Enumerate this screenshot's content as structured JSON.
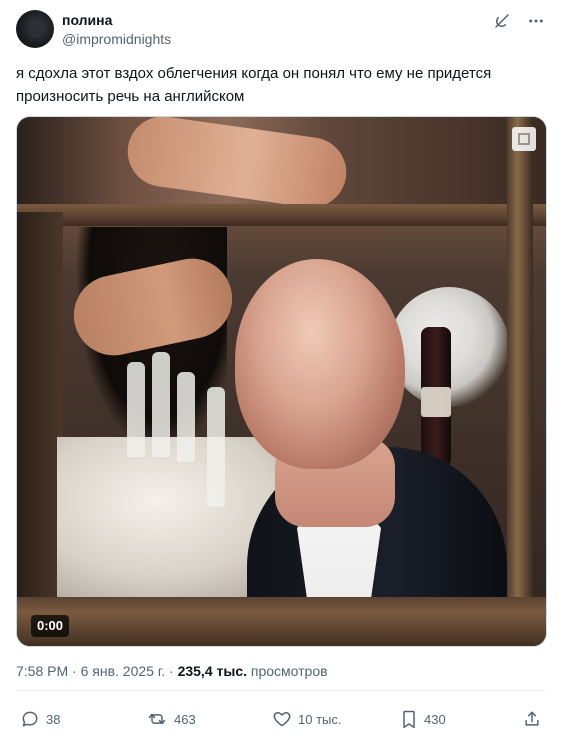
{
  "tweet": {
    "user": {
      "name": "полина",
      "handle": "@impromidnights"
    },
    "text": "я сдохла этот вздох облегчения когда он понял что ему не придется произносить речь на английском",
    "media": {
      "time": "0:00"
    },
    "meta": {
      "time": "7:58 PM",
      "sep1": " · ",
      "date": "6 янв. 2025 г.",
      "sep2": " · ",
      "views": "235,4 тыс.",
      "views_label": "просмотров"
    },
    "actions": {
      "reply_count": "38",
      "retweet_count": "463",
      "like_count": "10 тыс.",
      "bookmark_count": "430"
    },
    "icons": {
      "top_right": [
        "grok-icon",
        "more-icon"
      ],
      "action_bar": [
        "reply-icon",
        "retweet-icon",
        "like-icon",
        "bookmark-icon",
        "share-icon"
      ]
    },
    "colors": {
      "text_primary": "#0f1419",
      "text_secondary": "#536471",
      "border": "#cfd9de"
    }
  }
}
